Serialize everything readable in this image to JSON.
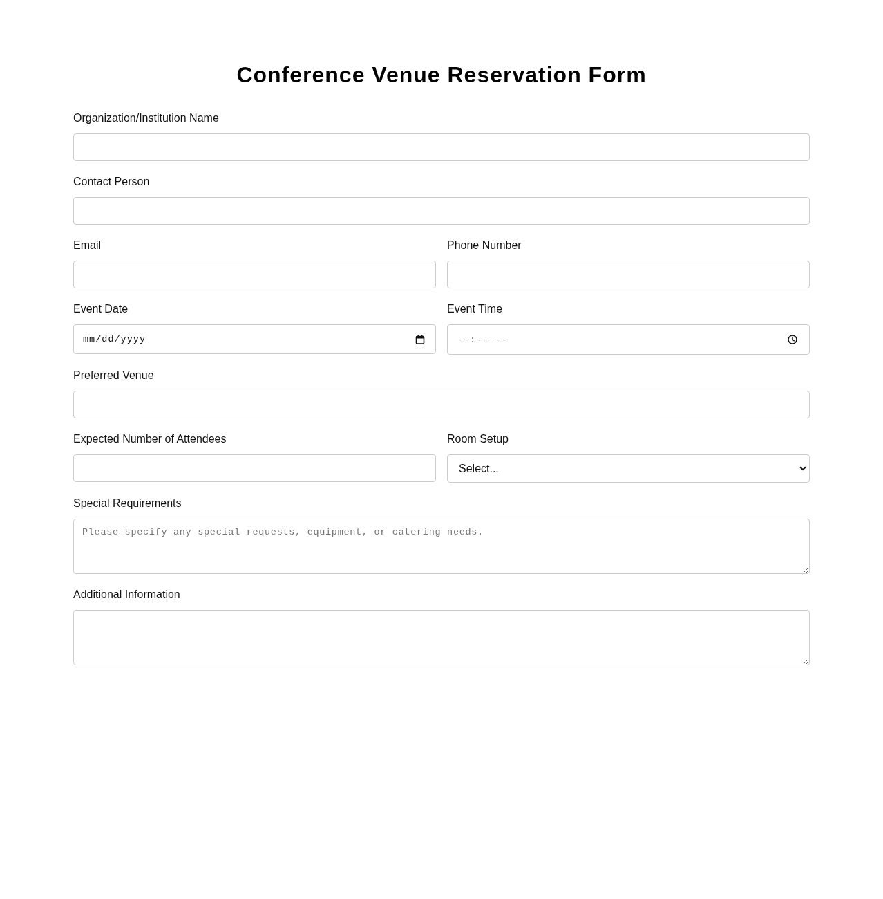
{
  "title": "Conference Venue Reservation Form",
  "rows": [
    {
      "fields": [
        {
          "label": "Organization/Institution Name",
          "kind": "text"
        }
      ]
    },
    {
      "fields": [
        {
          "label": "Contact Person",
          "kind": "text"
        }
      ]
    },
    {
      "fields": [
        {
          "label": "Email",
          "kind": "text"
        },
        {
          "label": "Phone Number",
          "kind": "text"
        }
      ]
    },
    {
      "fields": [
        {
          "label": "Event Date",
          "kind": "date",
          "placeholder": "mm/dd/yyyy"
        },
        {
          "label": "Event Time",
          "kind": "time",
          "placeholder": "--:-- --"
        }
      ]
    },
    {
      "fields": [
        {
          "label": "Preferred Venue",
          "kind": "text"
        }
      ]
    },
    {
      "fields": [
        {
          "label": "Expected Number of Attendees",
          "kind": "text"
        },
        {
          "label": "Room Setup",
          "kind": "select",
          "value": "Select..."
        }
      ]
    },
    {
      "fields": [
        {
          "label": "Special Requirements",
          "kind": "textarea",
          "placeholder": "Please specify any special requests, equipment, or catering needs."
        }
      ]
    },
    {
      "fields": [
        {
          "label": "Additional Information",
          "kind": "textarea"
        }
      ]
    }
  ]
}
